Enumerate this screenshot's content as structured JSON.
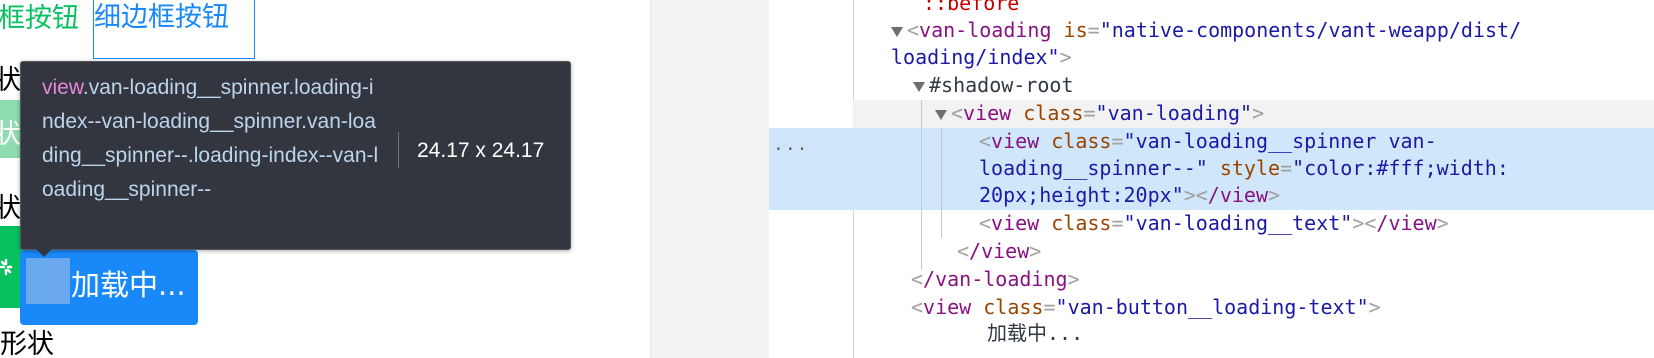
{
  "preview": {
    "plain_btn_green": "框按钮",
    "plain_btn_blue": "细边框按钮",
    "side_glyph_1": "状",
    "side_glyph_2": "状",
    "side_glyph_3": "状",
    "loading_btn_text": "加载中...",
    "shape_label": "形状"
  },
  "tooltip": {
    "tag": "view",
    "classes": ".van-loading__spinner.loading-index--van-loading__spinner.van-loading__spinner--.loading-index--van-loading__spinner--",
    "size": "24.17 x 24.17"
  },
  "tree": {
    "before": "::before",
    "van_loading_open_tag": "van-loading",
    "is_attr": "is",
    "is_val_1": "native-components/vant-weapp/dist/",
    "is_val_2": "loading/index",
    "shadow_root": "#shadow-root",
    "view_tag": "view",
    "class_attr": "class",
    "van_loading_class": "van-loading",
    "spinner_class_1": "van-loading__spinner van-",
    "spinner_class_2": "loading__spinner--",
    "style_attr": "style",
    "style_val_1": "color:#fff;width:",
    "style_val_2": "20px;height:20px",
    "close_view": "/view",
    "text_class": "van-loading__text",
    "close_van_loading": "/van-loading",
    "loading_text_class": "van-button__loading-text",
    "loading_text_content": "加载中...",
    "ellipsis": "..."
  },
  "colors": {
    "green": "#07c160",
    "blue": "#1989fa",
    "selected_row": "#cfe6fb"
  }
}
